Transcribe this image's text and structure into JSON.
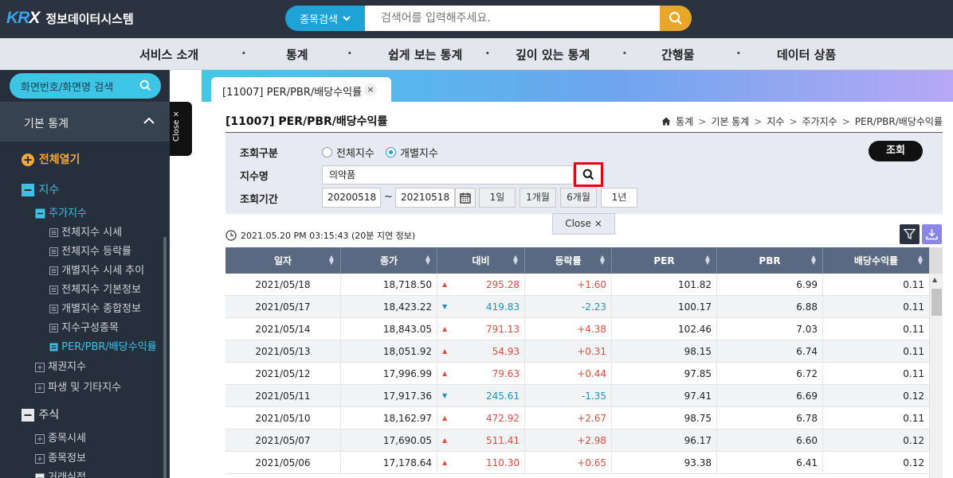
{
  "header": {
    "logo_text": "KRX",
    "system_name": "정보데이터시스템",
    "search_select": "종목검색",
    "search_placeholder": "검색어를 입력해주세요."
  },
  "nav": {
    "items": [
      "서비스 소개",
      "통계",
      "쉽게 보는 통계",
      "깊이 있는 통계",
      "간행물",
      "데이터 상품"
    ],
    "separator": "·"
  },
  "sidebar": {
    "search_placeholder": "화면번호/화면명 검색",
    "section_title": "기본 통계",
    "expand_all": "전체열기",
    "close_label": "Close ×",
    "tree": {
      "jisu": "지수",
      "jugajisu": "주가지수",
      "items": [
        "전체지수 시세",
        "전체지수 등락률",
        "개별지수 시세 추이",
        "전체지수 기본정보",
        "개별지수 종합정보",
        "지수구성종목",
        "PER/PBR/배당수익률"
      ],
      "chaegwon": "채권지수",
      "pasaeng": "파생 및 기타지수",
      "jusik": "주식",
      "jongmok_sise": "종목시세",
      "jongmok_info": "종목정보",
      "georae": "거래실적"
    }
  },
  "tab": {
    "label": "[11007] PER/PBR/배당수익률",
    "close": "×"
  },
  "page": {
    "title": "[11007] PER/PBR/배당수익률",
    "breadcrumb": [
      "통계",
      "기본 통계",
      "지수",
      "주가지수",
      "PER/PBR/배당수익률"
    ]
  },
  "query": {
    "type_label": "조회구분",
    "radio_all": "전체지수",
    "radio_individual": "개별지수",
    "index_label": "지수명",
    "index_value": "의약품",
    "period_label": "조회기간",
    "date_from": "20200518",
    "date_to": "20210518",
    "tilde": "~",
    "periods": [
      "1일",
      "1개월",
      "6개월",
      "1년"
    ],
    "search_button": "조회",
    "close_popup": "Close ×"
  },
  "timestamp": "2021.05.20 PM 03:15:43 (20분 지연 정보)",
  "table": {
    "columns": [
      "일자",
      "종가",
      "대비",
      "등락률",
      "PER",
      "PBR",
      "배당수익률"
    ],
    "rows": [
      {
        "date": "2021/05/18",
        "close": "18,718.50",
        "dir": "up",
        "change": "295.28",
        "rate": "+1.60",
        "per": "101.82",
        "pbr": "6.99",
        "div": "0.11"
      },
      {
        "date": "2021/05/17",
        "close": "18,423.22",
        "dir": "down",
        "change": "419.83",
        "rate": "-2.23",
        "per": "100.17",
        "pbr": "6.88",
        "div": "0.11"
      },
      {
        "date": "2021/05/14",
        "close": "18,843.05",
        "dir": "up",
        "change": "791.13",
        "rate": "+4.38",
        "per": "102.46",
        "pbr": "7.03",
        "div": "0.11"
      },
      {
        "date": "2021/05/13",
        "close": "18,051.92",
        "dir": "up",
        "change": "54.93",
        "rate": "+0.31",
        "per": "98.15",
        "pbr": "6.74",
        "div": "0.11"
      },
      {
        "date": "2021/05/12",
        "close": "17,996.99",
        "dir": "up",
        "change": "79.63",
        "rate": "+0.44",
        "per": "97.85",
        "pbr": "6.72",
        "div": "0.11"
      },
      {
        "date": "2021/05/11",
        "close": "17,917.36",
        "dir": "down",
        "change": "245.61",
        "rate": "-1.35",
        "per": "97.41",
        "pbr": "6.69",
        "div": "0.12"
      },
      {
        "date": "2021/05/10",
        "close": "18,162.97",
        "dir": "up",
        "change": "472.92",
        "rate": "+2.67",
        "per": "98.75",
        "pbr": "6.78",
        "div": "0.11"
      },
      {
        "date": "2021/05/07",
        "close": "17,690.05",
        "dir": "up",
        "change": "511.41",
        "rate": "+2.98",
        "per": "96.17",
        "pbr": "6.60",
        "div": "0.12"
      },
      {
        "date": "2021/05/06",
        "close": "17,178.64",
        "dir": "up",
        "change": "110.30",
        "rate": "+0.65",
        "per": "93.38",
        "pbr": "6.41",
        "div": "0.12"
      }
    ]
  },
  "colors": {
    "topbar": "#2b3340",
    "accent": "#1fa3d6",
    "search_button": "#e8a72a",
    "up": "#e64a3c",
    "down": "#1e8fc8"
  }
}
